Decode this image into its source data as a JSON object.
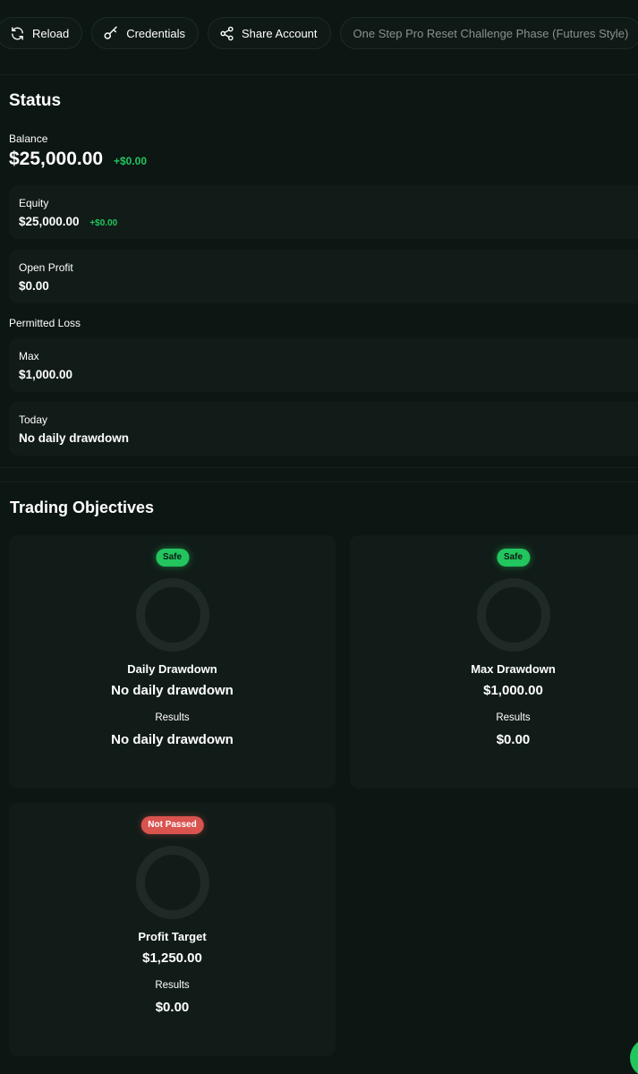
{
  "toolbar": {
    "reload_label": "Reload",
    "credentials_label": "Credentials",
    "share_label": "Share Account",
    "phase_label": "One Step Pro Reset Challenge Phase (Futures Style)"
  },
  "status": {
    "heading": "Status",
    "balance_label": "Balance",
    "balance_value": "$25,000.00",
    "balance_delta": "+$0.00",
    "equity_label": "Equity",
    "equity_value": "$25,000.00",
    "equity_delta": "+$0.00",
    "open_profit_label": "Open Profit",
    "open_profit_value": "$0.00",
    "permitted_loss_label": "Permitted Loss",
    "max_label": "Max",
    "max_value": "$1,000.00",
    "today_label": "Today",
    "today_value": "No daily drawdown"
  },
  "objectives": {
    "heading": "Trading Objectives",
    "cards": [
      {
        "badge": "Safe",
        "title": "Daily Drawdown",
        "value": "No daily drawdown",
        "results_label": "Results",
        "results_value": "No daily drawdown"
      },
      {
        "badge": "Safe",
        "title": "Max Drawdown",
        "value": "$1,000.00",
        "results_label": "Results",
        "results_value": "$0.00"
      },
      {
        "badge": "Not Passed",
        "title": "Profit Target",
        "value": "$1,250.00",
        "results_label": "Results",
        "results_value": "$0.00"
      }
    ]
  },
  "colors": {
    "background": "#0c1613",
    "card": "#111c18",
    "accent_green": "#22c55e",
    "fail_red": "#d9534f"
  },
  "icons": {
    "reload": "reload-icon",
    "credentials": "key-icon",
    "share": "share-icon"
  }
}
